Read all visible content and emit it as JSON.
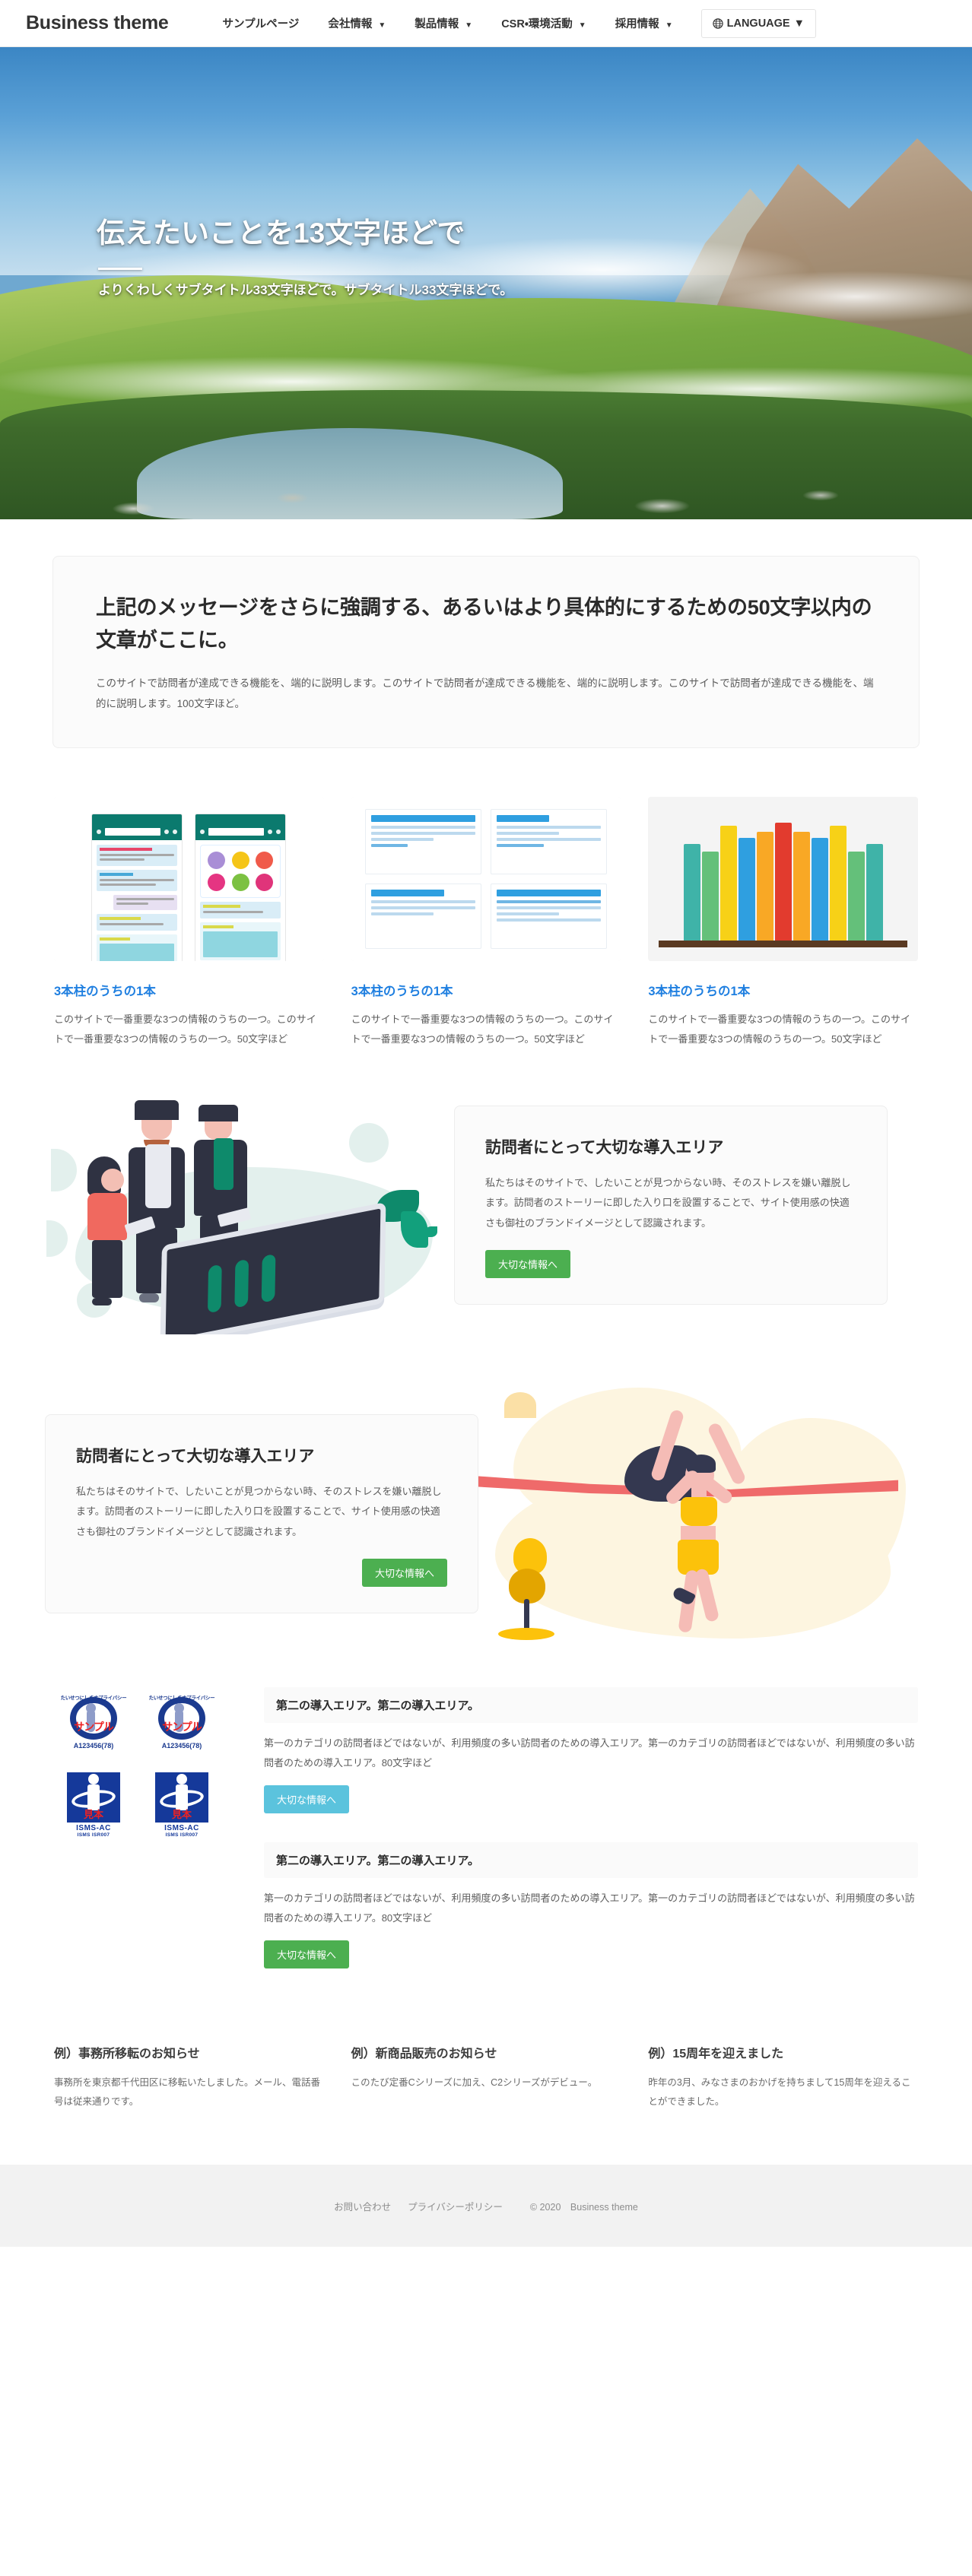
{
  "header": {
    "brand": "Business theme",
    "nav": [
      {
        "label": "サンプルページ",
        "has_dropdown": false
      },
      {
        "label": "会社情報",
        "has_dropdown": true
      },
      {
        "label": "製品情報",
        "has_dropdown": true
      },
      {
        "label": "CSR・環境活動",
        "has_dropdown": true
      },
      {
        "label": "採用情報",
        "has_dropdown": true
      }
    ],
    "language_switch": {
      "label": "LANGUAGE",
      "icon": "globe-icon",
      "caret": "▼"
    },
    "caret": "▼"
  },
  "hero": {
    "title": "伝えたいことを13文字ほどで",
    "subtitle": "よりくわしくサブタイトル33文字ほどで。サブタイトル33文字ほどで。"
  },
  "message": {
    "title": "上記のメッセージをさらに強調する、あるいはより具体的にするための50文字以内の文章がここに。",
    "body": "このサイトで訪問者が達成できる機能を、端的に説明します。このサイトで訪問者が達成できる機能を、端的に説明します。このサイトで訪問者が達成できる機能を、端的に説明します。100文字ほど。"
  },
  "pillars": [
    {
      "figure": "chat-app-illustration",
      "title": "3本柱のうちの1本",
      "text": "このサイトで一番重要な3つの情報のうちの一つ。このサイトで一番重要な3つの情報のうちの一つ。50文字ほど"
    },
    {
      "figure": "wireframe-illustration",
      "title": "3本柱のうちの1本",
      "text": "このサイトで一番重要な3つの情報のうちの一つ。このサイトで一番重要な3つの情報のうちの一つ。50文字ほど"
    },
    {
      "figure": "books-illustration",
      "title": "3本柱のうちの1本",
      "text": "このサイトで一番重要な3つの情報のうちの一つ。このサイトで一番重要な3つの情報のうちの一つ。50文字ほど"
    }
  ],
  "intro_areas": [
    {
      "figure": "business-people-tablet-illustration",
      "title": "訪問者にとって大切な導入エリア",
      "text": "私たちはそのサイトで、したいことが見つからない時、そのストレスを嫌い離脱します。訪問者のストーリーに即した入り口を設置することで、サイト使用感の快適さも御社のブランドイメージとして認識されます。",
      "button_label": "大切な情報へ",
      "button_color": "#4caf50"
    },
    {
      "figure": "runner-finish-line-illustration",
      "title": "訪問者にとって大切な導入エリア",
      "text": "私たちはそのサイトで、したいことが見つからない時、そのストレスを嫌い離脱します。訪問者のストーリーに即した入り口を設置することで、サイト使用感の快適さも御社のブランドイメージとして認識されます。",
      "button_label": "大切な情報へ",
      "button_color": "#4caf50"
    }
  ],
  "certifications": {
    "logos": [
      {
        "name": "privacy-mark-logo",
        "arc_text": "たいせつにしますプライバシー",
        "sample_text": "サンプル",
        "code": "A123456(78)"
      },
      {
        "name": "privacy-mark-logo",
        "arc_text": "たいせつにしますプライバシー",
        "sample_text": "サンプル",
        "code": "A123456(78)"
      },
      {
        "name": "isms-logo",
        "overlay_text": "見本",
        "label": "ISMS-AC",
        "sub": "ISMS        ISR007"
      },
      {
        "name": "isms-logo",
        "overlay_text": "見本",
        "label": "ISMS-AC",
        "sub": "ISMS        ISR007"
      }
    ],
    "blocks": [
      {
        "title": "第二の導入エリア。第二の導入エリア。",
        "text": "第一のカテゴリの訪問者ほどではないが、利用頻度の多い訪問者のための導入エリア。第一のカテゴリの訪問者ほどではないが、利用頻度の多い訪問者のための導入エリア。80文字ほど",
        "button_label": "大切な情報へ",
        "button_color": "#5bc3dd"
      },
      {
        "title": "第二の導入エリア。第二の導入エリア。",
        "text": "第一のカテゴリの訪問者ほどではないが、利用頻度の多い訪問者のための導入エリア。第一のカテゴリの訪問者ほどではないが、利用頻度の多い訪問者のための導入エリア。80文字ほど",
        "button_label": "大切な情報へ",
        "button_color": "#4caf50"
      }
    ]
  },
  "news": [
    {
      "title": "例）事務所移転のお知らせ",
      "text": "事務所を東京都千代田区に移転いたしました。メール、電話番号は従来通りです。"
    },
    {
      "title": "例）新商品販売のお知らせ",
      "text": "このたび定番Cシリーズに加え、C2シリーズがデビュー。"
    },
    {
      "title": "例）15周年を迎えました",
      "text": "昨年の3月、みなさまのおかげを持ちまして15周年を迎えることができました。"
    }
  ],
  "footer": {
    "links": [
      "お問い合わせ",
      "プライバシーポリシー"
    ],
    "copyright": "© 2020　Business theme"
  },
  "colors": {
    "accent_blue": "#1f7fe0",
    "green_button": "#4caf50",
    "cyan_button": "#5bc3dd",
    "text_dark": "#2b2b2b",
    "text_muted": "#5d5d5d",
    "footer_bg": "#f2f2f2"
  }
}
